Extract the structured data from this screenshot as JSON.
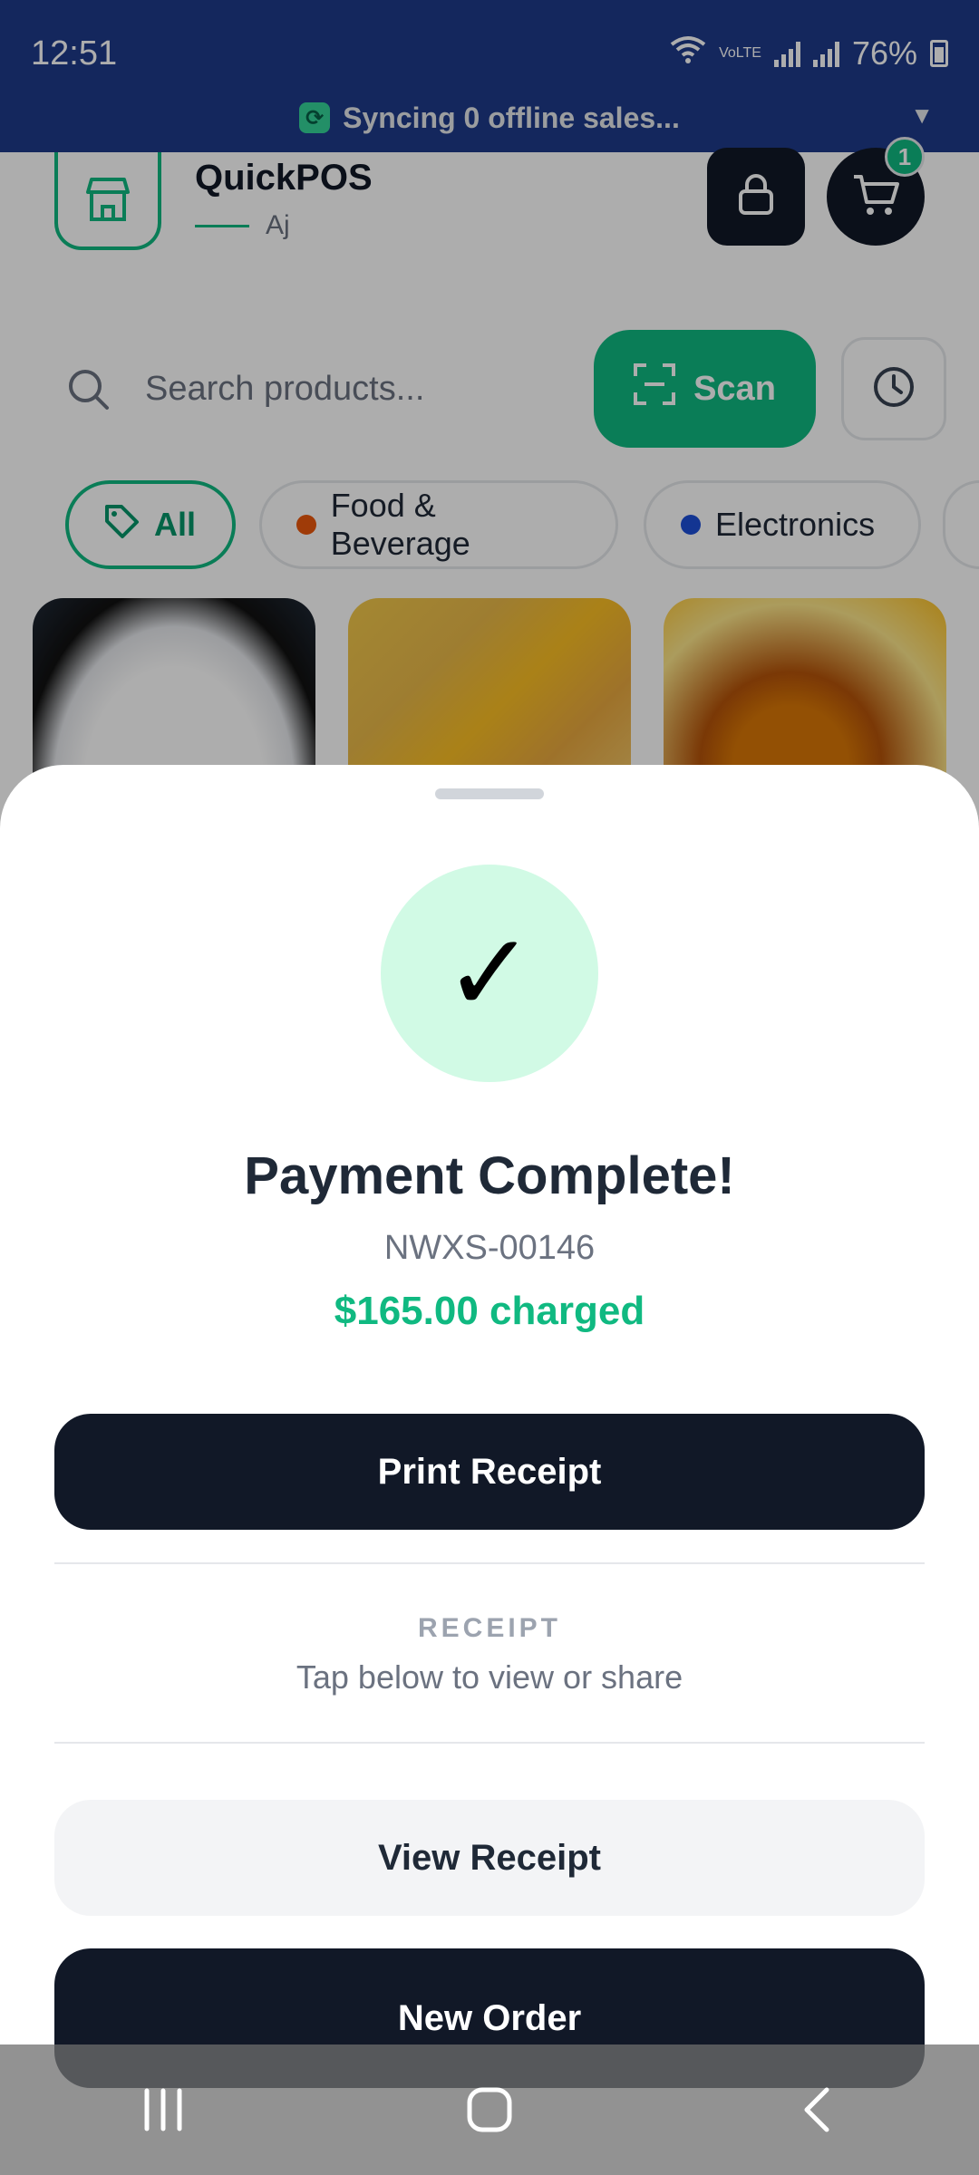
{
  "status_bar": {
    "time": "12:51",
    "network_label": "VoLTE",
    "battery": "76%"
  },
  "sync_banner": {
    "text": "Syncing 0 offline sales..."
  },
  "header": {
    "app_name": "QuickPOS",
    "user": "Aj",
    "cart_count": "1"
  },
  "search": {
    "placeholder": "Search products...",
    "scan_label": "Scan"
  },
  "categories": [
    {
      "label": "All",
      "color": "#10b981"
    },
    {
      "label": "Food & Beverage",
      "color": "#ea580c"
    },
    {
      "label": "Electronics",
      "color": "#1d4ed8"
    }
  ],
  "sheet": {
    "check_glyph": "✓",
    "title": "Payment Complete!",
    "order_id": "NWXS-00146",
    "charged": "$165.00 charged",
    "print_label": "Print Receipt",
    "receipt_section_label": "RECEIPT",
    "receipt_hint": "Tap below to view or share",
    "view_label": "View Receipt",
    "new_order_label": "New Order"
  },
  "colors": {
    "accent": "#10b981",
    "dark": "#111827",
    "status_bar": "#1e3a8a"
  },
  "icons": [
    "store-icon",
    "lock-icon",
    "cart-icon",
    "search-icon",
    "scan-icon",
    "history-icon",
    "tag-icon",
    "checkmark-icon",
    "recent-apps-icon",
    "home-icon",
    "back-icon"
  ]
}
